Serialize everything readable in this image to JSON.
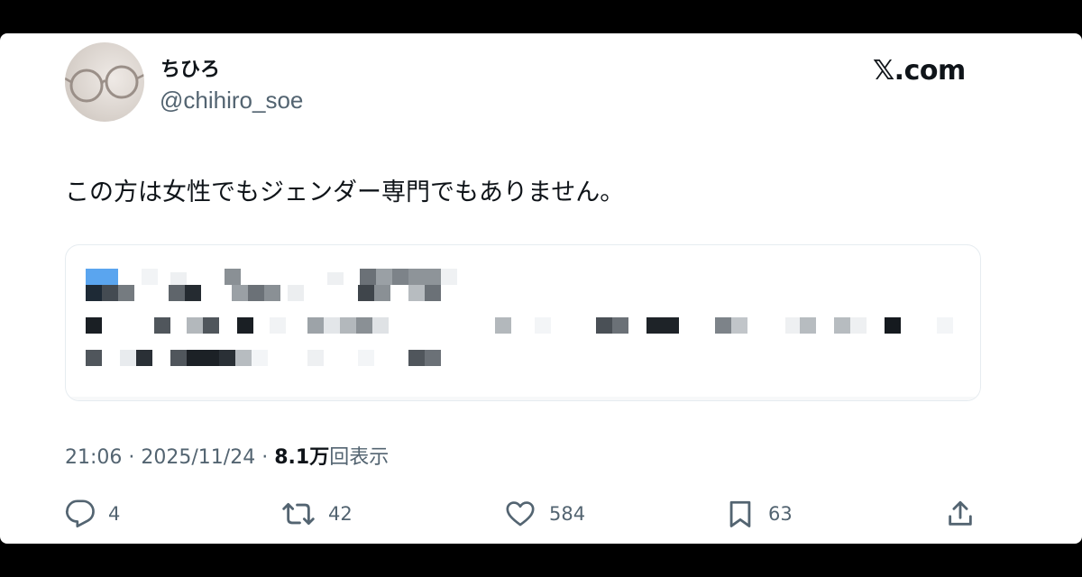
{
  "author": {
    "display_name": "ちひろ",
    "handle": "@chihiro_soe"
  },
  "site_label": "𝕏.com",
  "tweet": {
    "text": "この方は女性でもジェンダー専門でもありません。"
  },
  "meta": {
    "time": "21:06",
    "separator": "·",
    "date": "2025/11/24",
    "views_count": "8.1万",
    "views_label": "回表示"
  },
  "actions": {
    "replies": "4",
    "reposts": "42",
    "likes": "584",
    "bookmarks": "63"
  },
  "colors": {
    "text": "#0f1419",
    "secondary": "#536471",
    "pixel_accent": "#5aa5ef"
  }
}
